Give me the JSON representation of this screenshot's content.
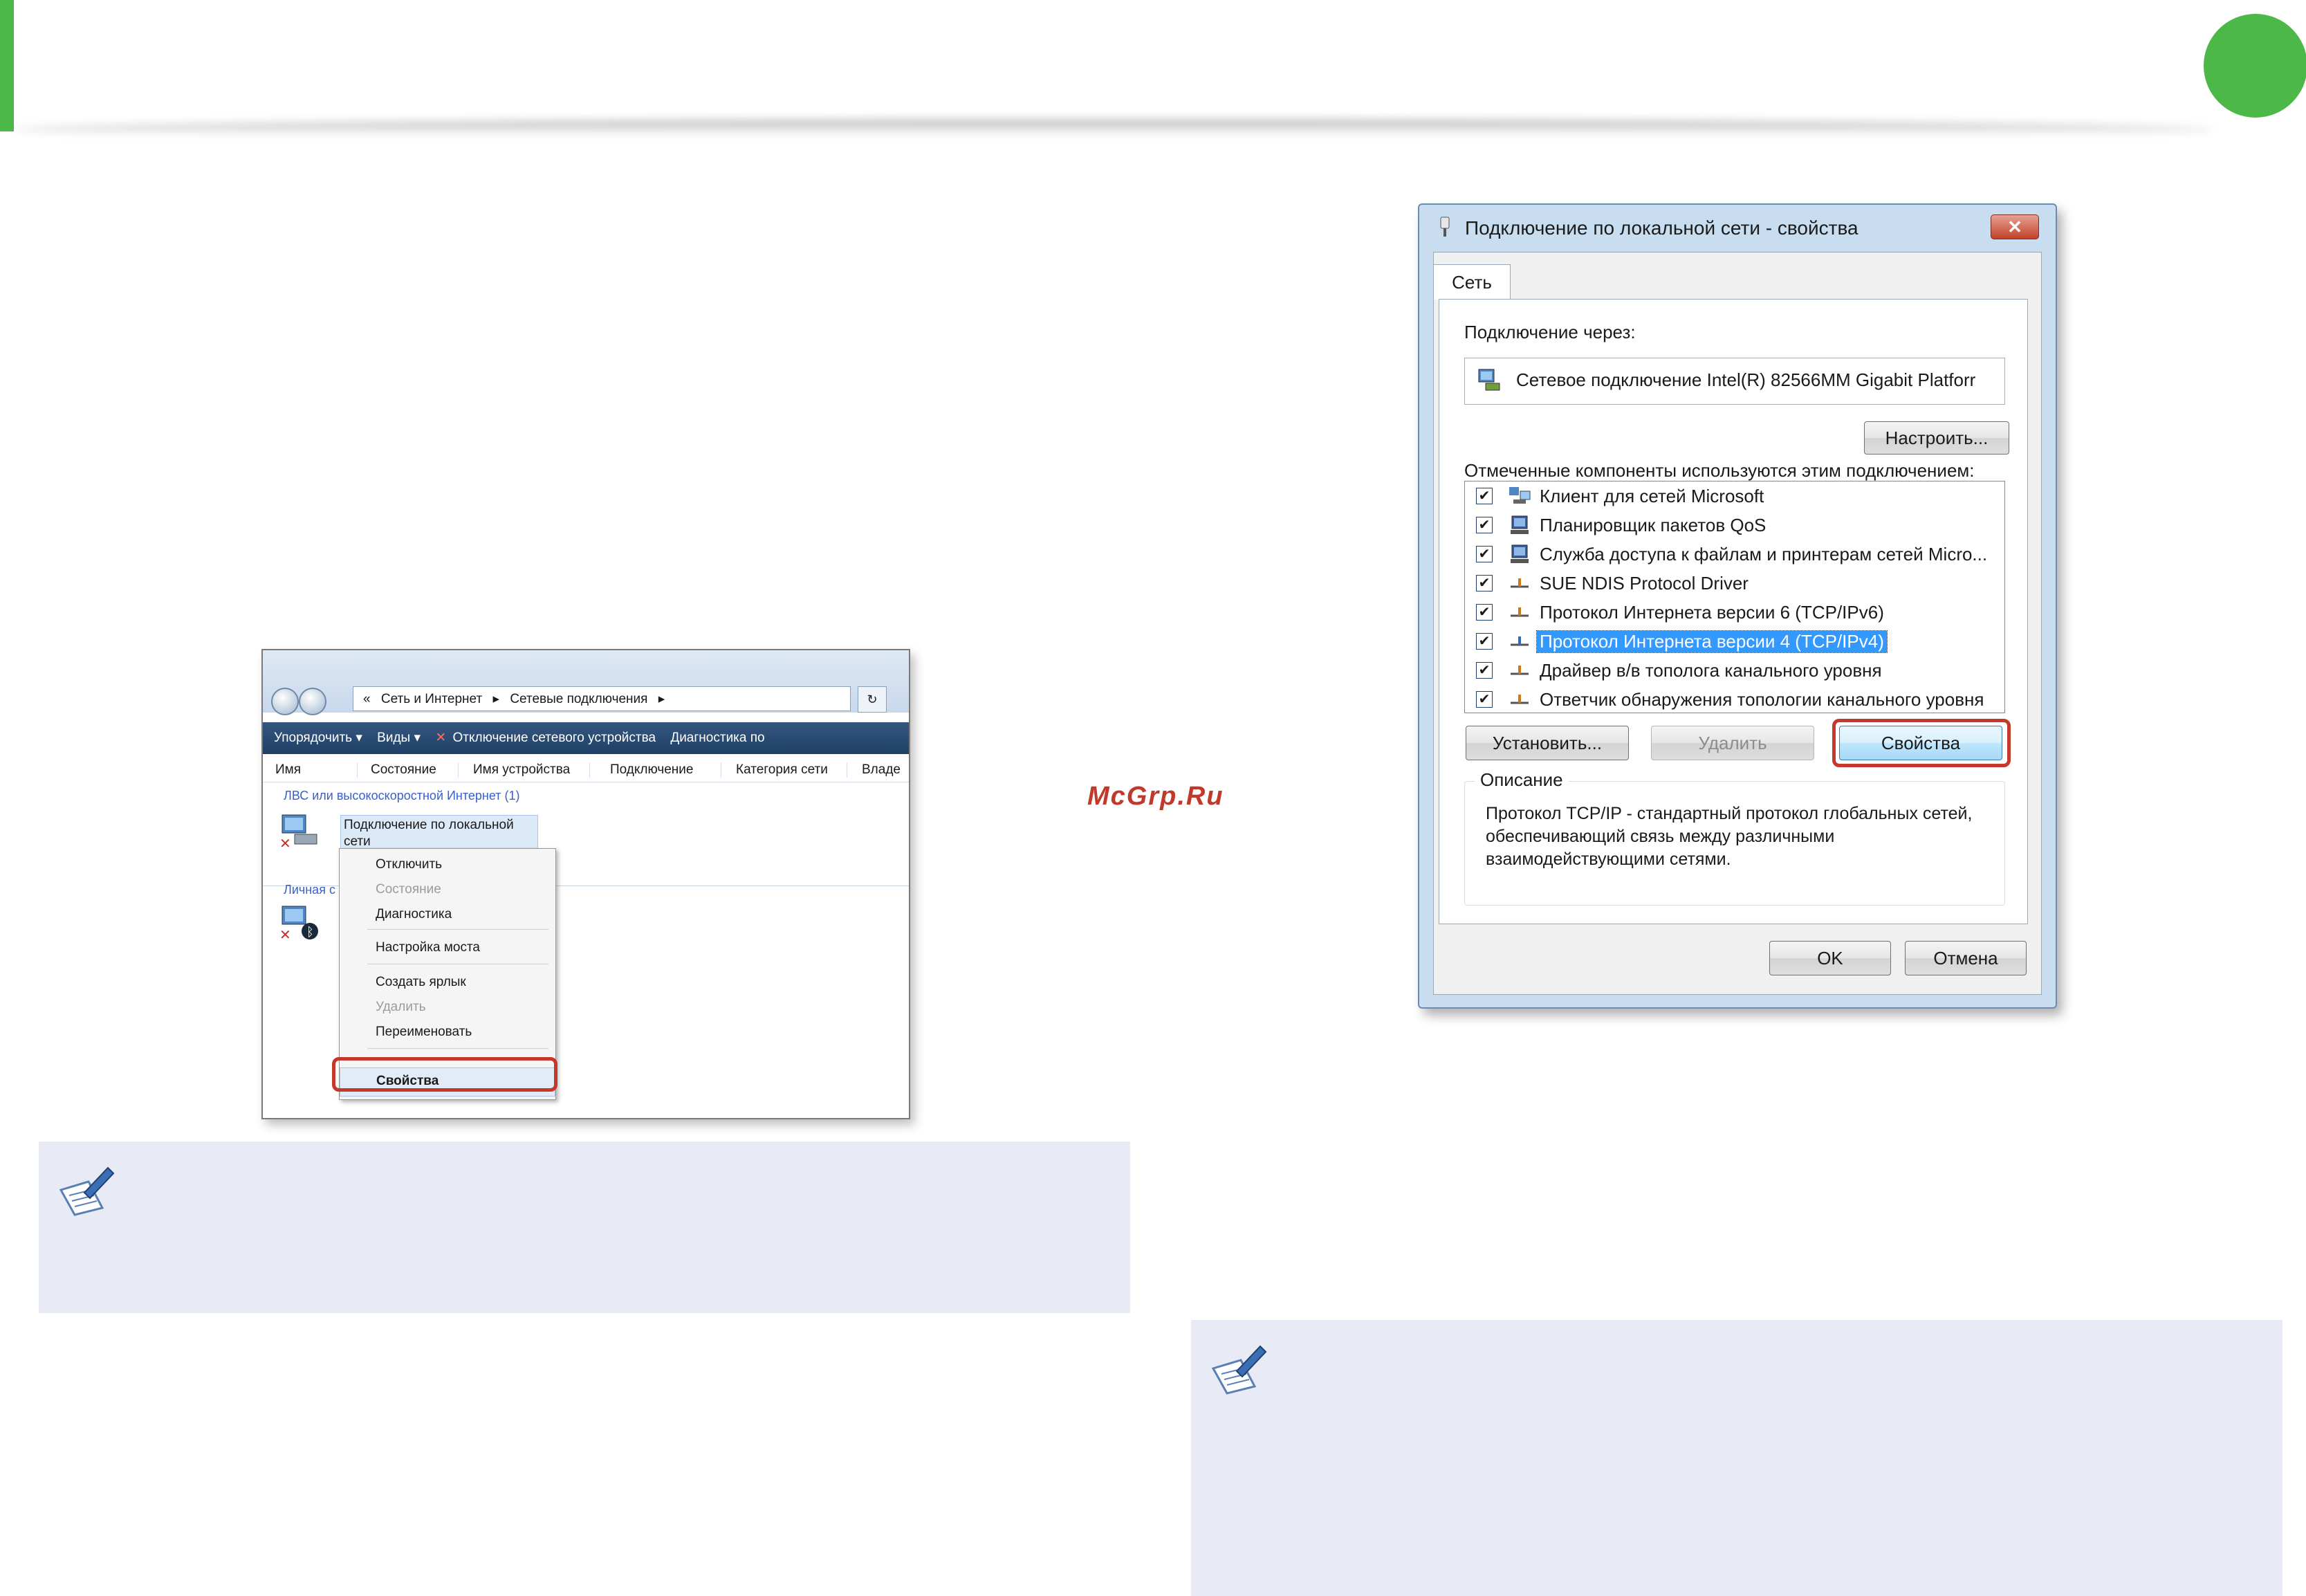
{
  "watermark": "McGrp.Ru",
  "explorer": {
    "breadcrumb": [
      "«",
      "Сеть и Интернет",
      "▸",
      "Сетевые подключения",
      "▸"
    ],
    "toolbar": [
      "Упорядочить ▾",
      "Виды ▾",
      "Отключение сетевого устройства",
      "Диагностика по"
    ],
    "columns": [
      "Имя",
      "Состояние",
      "Имя устройства",
      "Подключение",
      "Категория сети",
      "Владе"
    ],
    "group_lan": "ЛВС или высокоскоростной Интернет (1)",
    "group_personal": "Личная с",
    "item_label": "Подключение по локальной сети",
    "context_menu": {
      "disconnect": "Отключить",
      "status": "Состояние",
      "diagnostics": "Диагностика",
      "bridge": "Настройка моста",
      "shortcut": "Создать ярлык",
      "delete": "Удалить",
      "rename": "Переименовать",
      "properties": "Свойства"
    }
  },
  "dialog": {
    "title": "Подключение по локальной сети - свойства",
    "close": "✕",
    "tab": "Сеть",
    "connect_via_label": "Подключение через:",
    "adapter": "Сетевое подключение Intel(R) 82566MM Gigabit Platforr",
    "configure_button": "Настроить...",
    "components_label": "Отмеченные компоненты используются этим подключением:",
    "components": [
      {
        "name": "Клиент для сетей Microsoft",
        "checked": true,
        "selected": false,
        "icon": "network-client-icon"
      },
      {
        "name": "Планировщик пакетов QoS",
        "checked": true,
        "selected": false,
        "icon": "service-icon"
      },
      {
        "name": "Служба доступа к файлам и принтерам сетей Micro...",
        "checked": true,
        "selected": false,
        "icon": "service-icon"
      },
      {
        "name": "SUE NDIS Protocol Driver",
        "checked": true,
        "selected": false,
        "icon": "protocol-icon"
      },
      {
        "name": "Протокол Интернета версии 6 (TCP/IPv6)",
        "checked": true,
        "selected": false,
        "icon": "protocol-icon"
      },
      {
        "name": "Протокол Интернета версии 4 (TCP/IPv4)",
        "checked": true,
        "selected": true,
        "icon": "protocol-icon"
      },
      {
        "name": "Драйвер в/в тополога канального уровня",
        "checked": true,
        "selected": false,
        "icon": "protocol-icon"
      },
      {
        "name": "Ответчик обнаружения топологии канального уровня",
        "checked": true,
        "selected": false,
        "icon": "protocol-icon"
      }
    ],
    "install_button": "Установить...",
    "uninstall_button": "Удалить",
    "properties_button": "Свойства",
    "description_legend": "Описание",
    "description": "Протокол TCP/IP - стандартный протокол глобальных сетей, обеспечивающий связь между различными взаимодействующими сетями.",
    "ok_button": "OK",
    "cancel_button": "Отмена"
  }
}
